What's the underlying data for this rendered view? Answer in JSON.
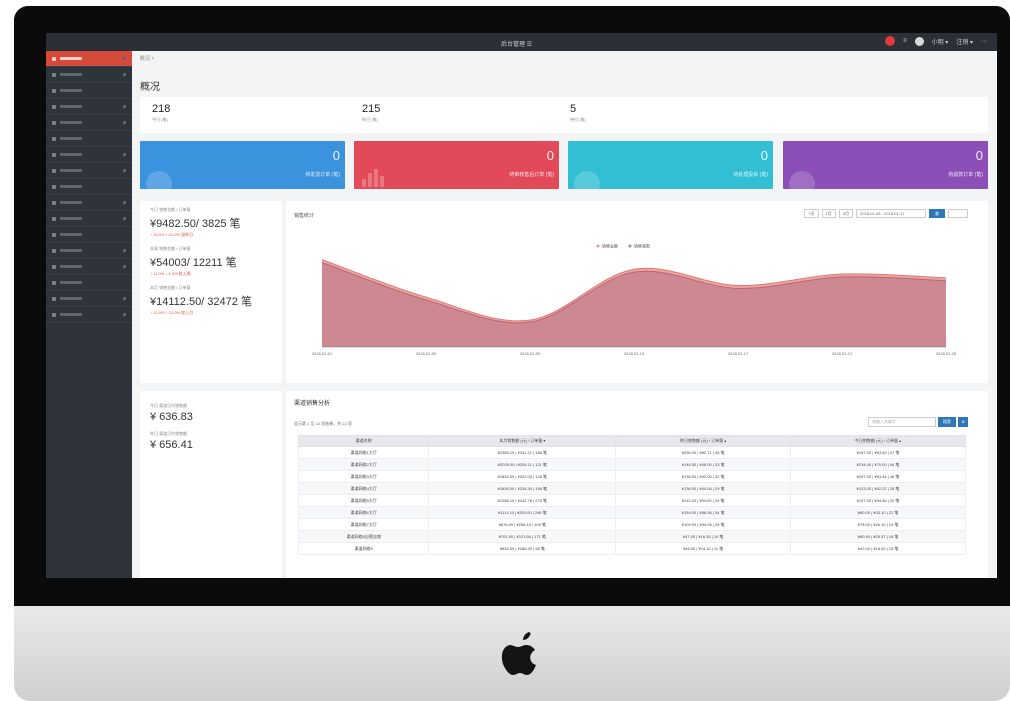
{
  "topbar": {
    "title": "后台管理 ☰",
    "right_items": [
      "1",
      "≡",
      "小明 ▾",
      "注销 ▾",
      "⋯"
    ]
  },
  "sidebar": {
    "item_count": 17,
    "active_index": 0
  },
  "breadcrumb": "概况 ×",
  "page_title": "概况",
  "stats": [
    {
      "num": "218",
      "label": "今日 (笔)"
    },
    {
      "num": "215",
      "label": "昨日 (笔)"
    },
    {
      "num": "5",
      "label": "待付 (笔)"
    }
  ],
  "cards": [
    {
      "num": "0",
      "label": "待发货订单 (笔)",
      "color": "#3b93de"
    },
    {
      "num": "0",
      "label": "待审核售后订单 (笔)",
      "color": "#e24a5a"
    },
    {
      "num": "0",
      "label": "待处理投诉 (笔)",
      "color": "#33bfd3"
    },
    {
      "num": "0",
      "label": "待退款订单 (笔)",
      "color": "#8c4fb8"
    }
  ],
  "left_stats": [
    {
      "label": "今日 销售金额 / 订单量",
      "value": "¥9482.50/ 3825 笔",
      "sub": "↑ 15.0% ↑ 21.0% 较昨日"
    },
    {
      "label": "本周 销售金额 / 订单量",
      "value": "¥54003/ 12211 笔",
      "sub": "↑ 11.0% ↓ 1.4% 较上周"
    },
    {
      "label": "本月 销售金额 / 订单量",
      "value": "¥14112.50/ 32472 笔",
      "sub": "↑ 12.5% ↑ 21.0% 较上月"
    }
  ],
  "chart_panel": {
    "title": "销售统计",
    "tools": [
      "7天",
      "1月",
      "3月"
    ],
    "date_range": "2018-01-08 - 2018-01-17",
    "go": "查"
  },
  "chart_data": {
    "type": "area",
    "title": "",
    "legend": [
      "销售金额",
      "销售笔数"
    ],
    "legend_placement": "top-center",
    "x": [
      "2018-01-01",
      "2018-01-05",
      "2018-01-09",
      "2018-01-13",
      "2018-01-17",
      "2018-01-21",
      "2018-01-25"
    ],
    "series": [
      {
        "name": "销售金额",
        "values": [
          9100,
          5200,
          2800,
          8100,
          6400,
          7600,
          7200
        ],
        "color": "#e9978f"
      },
      {
        "name": "销售笔数",
        "values": [
          8800,
          4900,
          2600,
          7800,
          6100,
          7300,
          6900
        ],
        "color": "#c47d8c"
      }
    ],
    "ylim": [
      0,
      10000
    ],
    "grid": false
  },
  "left_stats2": [
    {
      "label": "今日 渠道日均销售额",
      "value": "¥ 636.83"
    },
    {
      "label": "昨日 渠道日均销售额",
      "value": "¥ 656.41"
    }
  ],
  "table_panel": {
    "title": "渠道销售分析",
    "subtitle": "显示第 1 至 10 项结果，共 22 项",
    "search_placeholder": "请输入关键字",
    "search_btn": "搜索",
    "extra_btn": "⊕",
    "columns": [
      "渠道名称",
      "本月销售额 (元) / 订单量 ▾",
      "昨日销售额 (元) / 订单量 ▴",
      "今日销售额 (元) / 订单量 ▴"
    ],
    "rows": [
      [
        "渠道网络1大厅",
        "¥2385.10 | ¥341.21 | 186 笔",
        "¥290.00 | ¥82.71 | 45 笔",
        "¥157.00 | ¥63.00 | 47 笔"
      ],
      [
        "渠道网络2大厅",
        "¥2026.00 | ¥326.11 | 121 笔",
        "¥146.50 | ¥46.00 | 33 笔",
        "¥234.00 | ¥70.00 | 46 笔"
      ],
      [
        "渠道网络3大厅",
        "¥1834.00 | ¥322.00 | 126 笔",
        "¥136.00 | ¥42.00 | 32 笔",
        "¥207.00 | ¥63.44 | 46 笔"
      ],
      [
        "渠道网络4大厅",
        "¥1626.00 | ¥316.34 | 156 笔",
        "¥136.00 | ¥44.06 | 29 笔",
        "¥123.00 | ¥42.22 | 28 笔"
      ],
      [
        "渠道网络5大厅",
        "¥1288.10 | ¥412.78 | 275 笔",
        "¥112.00 | ¥34.00 | 24 笔",
        "¥107.00 | ¥34.46 | 20 笔"
      ],
      [
        "渠道网络6大厅",
        "¥1111.10 | ¥263.00 | 246 笔",
        "¥154.00 | ¥56.06 | 34 笔",
        "¥60.00 | ¥33.10 | 22 笔"
      ],
      [
        "渠道网络7大厅",
        "¥876.00 | ¥298.15 | 109 笔",
        "¥109.00 | ¥34.06 | 26 笔",
        "¥78.00 | ¥26.10 | 14 笔"
      ],
      [
        "渠道网络8自营店铺",
        "¥701.00 | ¥221.56 | 171 笔",
        "¥47.00 | ¥16.35 | 10 笔",
        "¥60.50 | ¥25.37 | 18 笔"
      ],
      [
        "渠道网络9",
        "¥634.00 | ¥186.20 | 98 笔",
        "¥46.00 | ¥14.10 | 11 笔",
        "¥42.00 | ¥18.00 | 15 笔"
      ]
    ]
  },
  "apple_logo": "apple-logo"
}
